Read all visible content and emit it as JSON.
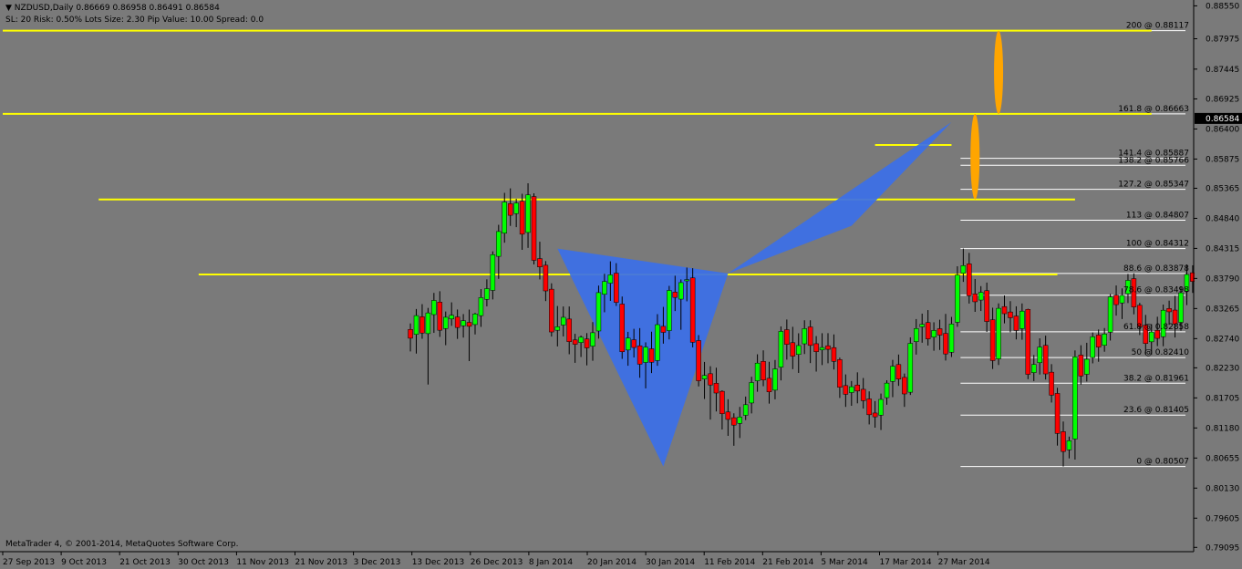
{
  "header": {
    "symbol": "NZDUSD,Daily",
    "ohlc": "0.86669 0.86958 0.86491 0.86584",
    "settings": "SL: 20 Risk: 0.50%  Lots Size: 2.30 Pip Value: 10.00 Spread: 0.0"
  },
  "footer": "MetaTrader 4, © 2001-2014, MetaQuotes Software Corp.",
  "colors": {
    "background": "#7a7a7a",
    "bull": "#00ff00",
    "bear": "#ff0000",
    "wick": "#000000",
    "fib": "#ffffff",
    "support": "#ffff00",
    "pattern": "#3b6fe8",
    "target": "#ffa500",
    "current_price_label": "#000000"
  },
  "chart_data": {
    "type": "candlestick",
    "y_axis_ticks": [
      "0.88550",
      "0.87975",
      "0.87445",
      "0.86925",
      "0.86400",
      "0.85875",
      "0.85365",
      "0.84840",
      "0.84315",
      "0.83790",
      "0.83265",
      "0.82740",
      "0.82230",
      "0.81705",
      "0.81180",
      "0.80655",
      "0.80130",
      "0.79605",
      "0.79095"
    ],
    "ylim": [
      0.7902,
      0.8862
    ],
    "x_axis_ticks": [
      "27 Sep 2013",
      "9 Oct 2013",
      "21 Oct 2013",
      "30 Oct 2013",
      "11 Nov 2013",
      "21 Nov 2013",
      "3 Dec 2013",
      "13 Dec 2013",
      "26 Dec 2013",
      "8 Jan 2014",
      "20 Jan 2014",
      "30 Jan 2014",
      "11 Feb 2014",
      "21 Feb 2014",
      "5 Mar 2014",
      "17 Mar 2014",
      "27 Mar 2014"
    ],
    "current_price": "0.86584",
    "fib_levels": [
      {
        "label": "0 @ 0.80507",
        "value": 0.80507
      },
      {
        "label": "23.6 @ 0.81405",
        "value": 0.81405
      },
      {
        "label": "38.2 @ 0.81961",
        "value": 0.81961
      },
      {
        "label": "50 @ 0.82410",
        "value": 0.8241
      },
      {
        "label": "61.8 @ 0.82858",
        "value": 0.82858
      },
      {
        "label": "78.6 @ 0.83498",
        "value": 0.83498
      },
      {
        "label": "88.6 @ 0.83878",
        "value": 0.83878
      },
      {
        "label": "100 @ 0.84312",
        "value": 0.84312
      },
      {
        "label": "113 @ 0.84807",
        "value": 0.84807
      },
      {
        "label": "127.2 @ 0.85347",
        "value": 0.85347
      },
      {
        "label": "138.2 @ 0.85766",
        "value": 0.85766
      },
      {
        "label": "141.4 @ 0.85887",
        "value": 0.85887
      },
      {
        "label": "161.8 @ 0.86663",
        "value": 0.86663
      },
      {
        "label": "200 @ 0.88117",
        "value": 0.88117
      }
    ],
    "support_lines": [
      {
        "value": 0.88117,
        "from": 0,
        "to": 195
      },
      {
        "value": 0.86663,
        "from": 0,
        "to": 195
      },
      {
        "value": 0.8517,
        "from": 16,
        "to": 182
      },
      {
        "value": 0.8386,
        "from": 33,
        "to": 179
      },
      {
        "value": 0.8612,
        "from": 148,
        "to": 161
      }
    ],
    "pattern_points": [
      {
        "bar": 94,
        "price": 0.84312
      },
      {
        "bar": 112,
        "price": 0.80507
      },
      {
        "bar": 123,
        "price": 0.83878
      },
      {
        "bar": 161,
        "price": 0.8652
      },
      {
        "bar": 144,
        "price": 0.8471
      }
    ],
    "targets": [
      {
        "bar": 169,
        "top": 0.88117,
        "bottom": 0.86663
      },
      {
        "bar": 165,
        "top": 0.86663,
        "bottom": 0.8517
      }
    ],
    "candles": [
      [
        0.829,
        0.83005,
        0.82516,
        0.82747
      ],
      [
        0.82814,
        0.83257,
        0.82478,
        0.83142
      ],
      [
        0.83122,
        0.83342,
        0.82737,
        0.82837
      ],
      [
        0.82827,
        0.83276,
        0.81938,
        0.83189
      ],
      [
        0.83159,
        0.83538,
        0.8284,
        0.83407
      ],
      [
        0.83377,
        0.83567,
        0.8277,
        0.82886
      ],
      [
        0.82916,
        0.83213,
        0.82625,
        0.83113
      ],
      [
        0.83083,
        0.83373,
        0.82963,
        0.83148
      ],
      [
        0.83118,
        0.83248,
        0.82735,
        0.82934
      ],
      [
        0.82964,
        0.83168,
        0.82758,
        0.83053
      ],
      [
        0.83023,
        0.83247,
        0.82348,
        0.82955
      ],
      [
        0.82985,
        0.83192,
        0.82813,
        0.83171
      ],
      [
        0.83141,
        0.83604,
        0.82945,
        0.83456
      ],
      [
        0.83426,
        0.83775,
        0.83303,
        0.83612
      ],
      [
        0.83582,
        0.84263,
        0.83424,
        0.84206
      ],
      [
        0.84176,
        0.84727,
        0.83783,
        0.8461
      ],
      [
        0.8458,
        0.85285,
        0.84414,
        0.85125
      ],
      [
        0.85095,
        0.85363,
        0.84708,
        0.84893
      ],
      [
        0.84923,
        0.8518,
        0.84686,
        0.85108
      ],
      [
        0.85138,
        0.85269,
        0.8429,
        0.84563
      ],
      [
        0.84593,
        0.85452,
        0.84324,
        0.8525
      ],
      [
        0.8522,
        0.85277,
        0.84035,
        0.84107
      ],
      [
        0.84137,
        0.84432,
        0.83773,
        0.83991
      ],
      [
        0.84021,
        0.84094,
        0.83395,
        0.83573
      ],
      [
        0.83603,
        0.83706,
        0.82776,
        0.82856
      ],
      [
        0.82886,
        0.83309,
        0.82604,
        0.82947
      ],
      [
        0.82977,
        0.83301,
        0.82778,
        0.83112
      ],
      [
        0.83082,
        0.83301,
        0.82467,
        0.82687
      ],
      [
        0.82717,
        0.82824,
        0.82317,
        0.82641
      ],
      [
        0.82671,
        0.82793,
        0.82419,
        0.82764
      ],
      [
        0.82734,
        0.82836,
        0.82273,
        0.82578
      ],
      [
        0.82608,
        0.83028,
        0.82353,
        0.82843
      ],
      [
        0.82873,
        0.83666,
        0.8274,
        0.83543
      ],
      [
        0.83513,
        0.83872,
        0.832,
        0.83738
      ],
      [
        0.83708,
        0.84089,
        0.83399,
        0.83853
      ],
      [
        0.83883,
        0.84057,
        0.8331,
        0.83373
      ],
      [
        0.83343,
        0.83475,
        0.82386,
        0.82511
      ],
      [
        0.82541,
        0.82858,
        0.82266,
        0.8275
      ],
      [
        0.8272,
        0.82911,
        0.8241,
        0.82585
      ],
      [
        0.82615,
        0.82923,
        0.82056,
        0.82293
      ],
      [
        0.82323,
        0.82675,
        0.81871,
        0.82592
      ],
      [
        0.82562,
        0.82861,
        0.82138,
        0.82327
      ],
      [
        0.82357,
        0.83167,
        0.82265,
        0.82984
      ],
      [
        0.82954,
        0.83294,
        0.82652,
        0.82849
      ],
      [
        0.82879,
        0.83661,
        0.82726,
        0.83581
      ],
      [
        0.83551,
        0.83838,
        0.83221,
        0.83459
      ],
      [
        0.83429,
        0.83773,
        0.82894,
        0.83718
      ],
      [
        0.83748,
        0.8398,
        0.83391,
        0.8377
      ],
      [
        0.838,
        0.8397,
        0.82587,
        0.82676
      ],
      [
        0.82706,
        0.82801,
        0.81905,
        0.82004
      ],
      [
        0.82034,
        0.82333,
        0.81686,
        0.82097
      ],
      [
        0.82127,
        0.82258,
        0.81326,
        0.8193
      ],
      [
        0.8196,
        0.82232,
        0.81468,
        0.8179
      ],
      [
        0.8182,
        0.81838,
        0.81153,
        0.81429
      ],
      [
        0.81459,
        0.81681,
        0.81042,
        0.81329
      ],
      [
        0.81359,
        0.81436,
        0.80869,
        0.8123
      ],
      [
        0.8126,
        0.81548,
        0.81004,
        0.81371
      ],
      [
        0.81401,
        0.81728,
        0.81317,
        0.81586
      ],
      [
        0.81616,
        0.82074,
        0.81434,
        0.81973
      ],
      [
        0.82003,
        0.82466,
        0.81812,
        0.82312
      ],
      [
        0.82342,
        0.82535,
        0.81909,
        0.82017
      ],
      [
        0.82047,
        0.82336,
        0.81606,
        0.8181
      ],
      [
        0.8184,
        0.82367,
        0.8168,
        0.82211
      ],
      [
        0.82241,
        0.82953,
        0.8201,
        0.82866
      ],
      [
        0.82896,
        0.83073,
        0.82373,
        0.82639
      ],
      [
        0.82669,
        0.82946,
        0.82207,
        0.82433
      ],
      [
        0.82463,
        0.82833,
        0.82141,
        0.82619
      ],
      [
        0.82649,
        0.8306,
        0.82471,
        0.82914
      ],
      [
        0.82944,
        0.8306,
        0.82313,
        0.82621
      ],
      [
        0.82651,
        0.82784,
        0.82164,
        0.82512
      ],
      [
        0.82542,
        0.82834,
        0.82278,
        0.82585
      ],
      [
        0.82615,
        0.82834,
        0.82309,
        0.82553
      ],
      [
        0.82583,
        0.82813,
        0.82201,
        0.82343
      ],
      [
        0.82373,
        0.82408,
        0.81704,
        0.8189
      ],
      [
        0.8192,
        0.82115,
        0.81548,
        0.81768
      ],
      [
        0.81798,
        0.82,
        0.81567,
        0.819
      ],
      [
        0.8193,
        0.82151,
        0.8161,
        0.81825
      ],
      [
        0.81855,
        0.82052,
        0.81519,
        0.81657
      ],
      [
        0.81687,
        0.81819,
        0.81242,
        0.81411
      ],
      [
        0.81441,
        0.81649,
        0.81185,
        0.81374
      ],
      [
        0.81404,
        0.81781,
        0.81144,
        0.81679
      ],
      [
        0.81709,
        0.82013,
        0.81586,
        0.81963
      ],
      [
        0.81993,
        0.82369,
        0.81718,
        0.82257
      ],
      [
        0.82287,
        0.82462,
        0.81915,
        0.82033
      ],
      [
        0.82063,
        0.8213,
        0.81548,
        0.81774
      ],
      [
        0.81804,
        0.82762,
        0.81756,
        0.82657
      ],
      [
        0.82687,
        0.83081,
        0.82461,
        0.82916
      ],
      [
        0.82946,
        0.83176,
        0.82668,
        0.8299
      ],
      [
        0.8302,
        0.83238,
        0.82619,
        0.82735
      ],
      [
        0.82765,
        0.83025,
        0.82528,
        0.82883
      ],
      [
        0.82913,
        0.8307,
        0.82542,
        0.82801
      ],
      [
        0.82831,
        0.83171,
        0.82357,
        0.82472
      ],
      [
        0.82502,
        0.83119,
        0.82419,
        0.82995
      ],
      [
        0.83025,
        0.84003,
        0.82946,
        0.8385
      ],
      [
        0.8388,
        0.84312,
        0.8373,
        0.84015
      ],
      [
        0.84045,
        0.84236,
        0.83352,
        0.8349
      ],
      [
        0.8352,
        0.83781,
        0.83207,
        0.83383
      ],
      [
        0.83413,
        0.83656,
        0.83222,
        0.83547
      ],
      [
        0.83577,
        0.83718,
        0.82856,
        0.83039
      ],
      [
        0.83069,
        0.8328,
        0.8221,
        0.82356
      ],
      [
        0.82386,
        0.83355,
        0.82279,
        0.83269
      ],
      [
        0.83299,
        0.83493,
        0.83006,
        0.83175
      ],
      [
        0.83205,
        0.83394,
        0.82851,
        0.83104
      ],
      [
        0.83134,
        0.83304,
        0.82726,
        0.82883
      ],
      [
        0.82913,
        0.83354,
        0.8272,
        0.8322
      ],
      [
        0.8325,
        0.83262,
        0.82032,
        0.82116
      ],
      [
        0.82146,
        0.82453,
        0.81999,
        0.82289
      ],
      [
        0.82319,
        0.82745,
        0.82113,
        0.82592
      ],
      [
        0.82622,
        0.82792,
        0.82026,
        0.82124
      ],
      [
        0.82154,
        0.82294,
        0.81624,
        0.81753
      ],
      [
        0.81783,
        0.81881,
        0.80872,
        0.81085
      ],
      [
        0.81115,
        0.81292,
        0.80507,
        0.80769
      ],
      [
        0.80799,
        0.81029,
        0.80649,
        0.80957
      ],
      [
        0.80987,
        0.82534,
        0.80628,
        0.82422
      ],
      [
        0.82452,
        0.82624,
        0.81937,
        0.82087
      ],
      [
        0.82117,
        0.82667,
        0.81991,
        0.8238
      ],
      [
        0.8241,
        0.82848,
        0.82308,
        0.82772
      ],
      [
        0.82802,
        0.82899,
        0.82336,
        0.82592
      ],
      [
        0.82622,
        0.82924,
        0.82511,
        0.82821
      ],
      [
        0.82851,
        0.8352,
        0.82706,
        0.83468
      ],
      [
        0.83498,
        0.83668,
        0.83141,
        0.83333
      ],
      [
        0.83363,
        0.83617,
        0.83082,
        0.83494
      ],
      [
        0.83524,
        0.8387,
        0.83361,
        0.83757
      ],
      [
        0.83787,
        0.83878,
        0.83164,
        0.83292
      ],
      [
        0.83322,
        0.83364,
        0.82802,
        0.82946
      ],
      [
        0.82976,
        0.83154,
        0.82459,
        0.82654
      ],
      [
        0.82684,
        0.82993,
        0.82456,
        0.82855
      ],
      [
        0.82885,
        0.83122,
        0.82609,
        0.82744
      ],
      [
        0.82774,
        0.83334,
        0.82607,
        0.83236
      ],
      [
        0.83266,
        0.83403,
        0.82981,
        0.83208
      ],
      [
        0.83238,
        0.83487,
        0.8276,
        0.82994
      ],
      [
        0.83024,
        0.83653,
        0.82879,
        0.8354
      ],
      [
        0.8357,
        0.84034,
        0.83325,
        0.8386
      ],
      [
        0.8389,
        0.8402,
        0.83538,
        0.83738
      ],
      [
        0.83768,
        0.83992,
        0.83562,
        0.83645
      ],
      [
        0.83675,
        0.84097,
        0.83546,
        0.83842
      ],
      [
        0.83872,
        0.84519,
        0.83768,
        0.8441
      ],
      [
        0.8444,
        0.85146,
        0.84386,
        0.85037
      ],
      [
        0.85067,
        0.85169,
        0.84666,
        0.84887
      ],
      [
        0.84917,
        0.8512,
        0.84599,
        0.84834
      ],
      [
        0.84864,
        0.85303,
        0.84713,
        0.8515
      ],
      [
        0.8518,
        0.85812,
        0.8505,
        0.8564
      ],
      [
        0.8567,
        0.86236,
        0.85327,
        0.85476
      ],
      [
        0.85506,
        0.85688,
        0.85258,
        0.85391
      ],
      [
        0.85421,
        0.8594,
        0.85247,
        0.85812
      ],
      [
        0.85842,
        0.8633,
        0.85548,
        0.8619
      ],
      [
        0.8622,
        0.86304,
        0.85247,
        0.85374
      ],
      [
        0.85404,
        0.85472,
        0.8494,
        0.85309
      ],
      [
        0.85339,
        0.8555,
        0.85049,
        0.85338
      ],
      [
        0.85368,
        0.85602,
        0.85143,
        0.85497
      ],
      [
        0.85527,
        0.85825,
        0.85284,
        0.85757
      ],
      [
        0.85787,
        0.8604,
        0.85625,
        0.85959
      ],
      [
        0.85989,
        0.86768,
        0.8591,
        0.86669
      ],
      [
        0.86669,
        0.86958,
        0.86491,
        0.86584
      ]
    ],
    "bar_offset": 69
  }
}
